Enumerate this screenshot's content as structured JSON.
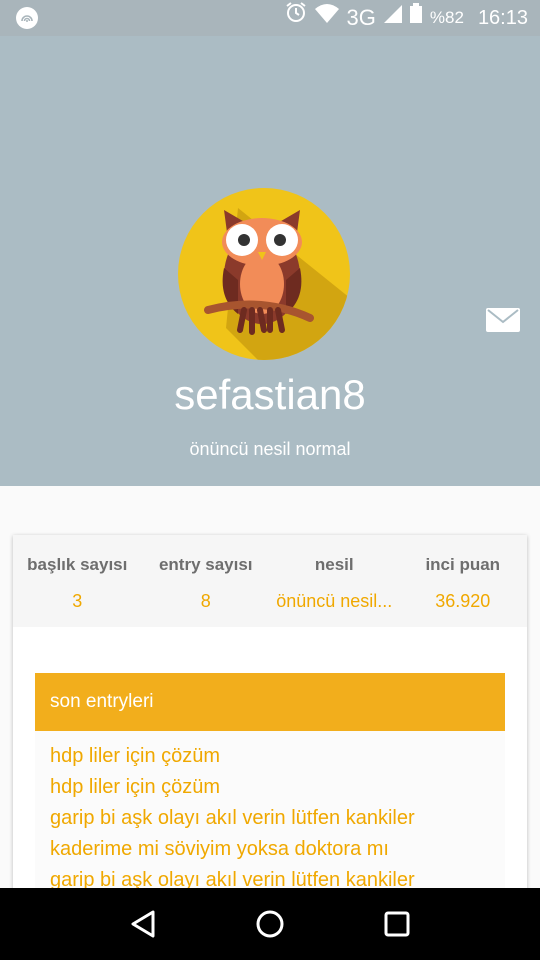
{
  "status_bar": {
    "network": "3G",
    "battery": "%82",
    "time": "16:13"
  },
  "profile": {
    "username": "sefastian8",
    "generation": "önüncü nesil normal"
  },
  "stats": [
    {
      "label": "başlık sayısı",
      "value": "3"
    },
    {
      "label": "entry sayısı",
      "value": "8"
    },
    {
      "label": "nesil",
      "value": "önüncü nesil..."
    },
    {
      "label": "inci puan",
      "value": "36.920"
    }
  ],
  "entries": {
    "title": "son entryleri",
    "items": [
      "hdp liler için çözüm",
      "hdp liler için çözüm",
      "garip bi aşk olayı akıl verin lütfen kankiler",
      "kaderime mi söviyim yoksa doktora mı",
      "garip bi aşk olayı akıl verin lütfen kankiler"
    ]
  },
  "colors": {
    "header_bg": "#abbcc4",
    "accent": "#f2ae1c",
    "avatar_bg": "#f0c419"
  },
  "icons": [
    "app-notification-icon",
    "alarm-icon",
    "wifi-icon",
    "signal-icon",
    "battery-icon",
    "mail-icon",
    "owl-avatar",
    "back-icon",
    "home-icon",
    "recents-icon"
  ]
}
